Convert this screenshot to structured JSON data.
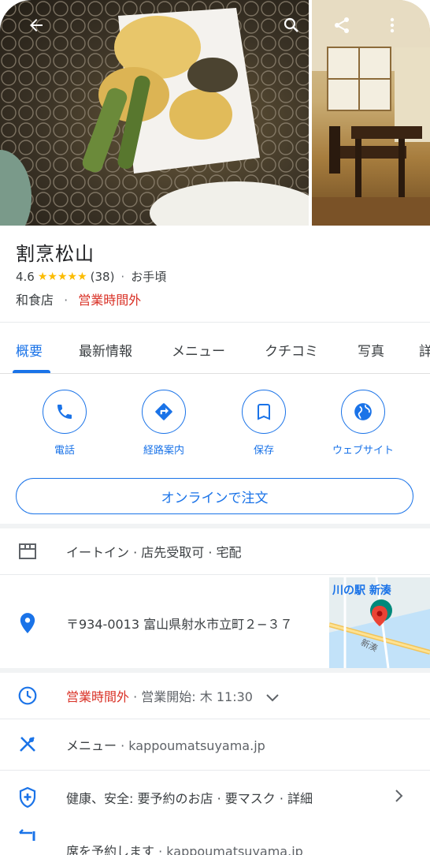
{
  "place": {
    "name": "割烹松山",
    "rating": "4.6",
    "stars": "★★★★★",
    "review_count": "(38)",
    "price": "お手頃",
    "category": "和食店",
    "status": "営業時間外",
    "separator": "·"
  },
  "tabs": [
    {
      "label": "概要"
    },
    {
      "label": "最新情報"
    },
    {
      "label": "メニュー"
    },
    {
      "label": "クチコミ"
    },
    {
      "label": "写真"
    },
    {
      "label": "詳"
    }
  ],
  "actions": [
    {
      "label": "電話",
      "icon": "phone-icon"
    },
    {
      "label": "経路案内",
      "icon": "directions-icon"
    },
    {
      "label": "保存",
      "icon": "bookmark-icon"
    },
    {
      "label": "ウェブサイト",
      "icon": "globe-icon"
    }
  ],
  "order_button": "オンラインで注文",
  "info": {
    "services": "イートイン · 店先受取可 · 宅配",
    "address": "〒934-0013 富山県射水市立町２−３７",
    "hours_status": "営業時間外",
    "hours_next": " · 営業開始: 木 11:30",
    "menu_label": "メニュー",
    "menu_site": " · kappoumatsuyama.jp",
    "health": "健康、安全: 要予約のお店 · 要マスク · 詳細",
    "reserve_label": "席を予約します",
    "reserve_site": " · kappoumatsuyama.jp"
  },
  "map": {
    "label": "川の駅 新湊",
    "road_label": "新湊"
  },
  "colors": {
    "accent": "#1a73e8",
    "closed": "#d93025",
    "star": "#fbbc04"
  }
}
